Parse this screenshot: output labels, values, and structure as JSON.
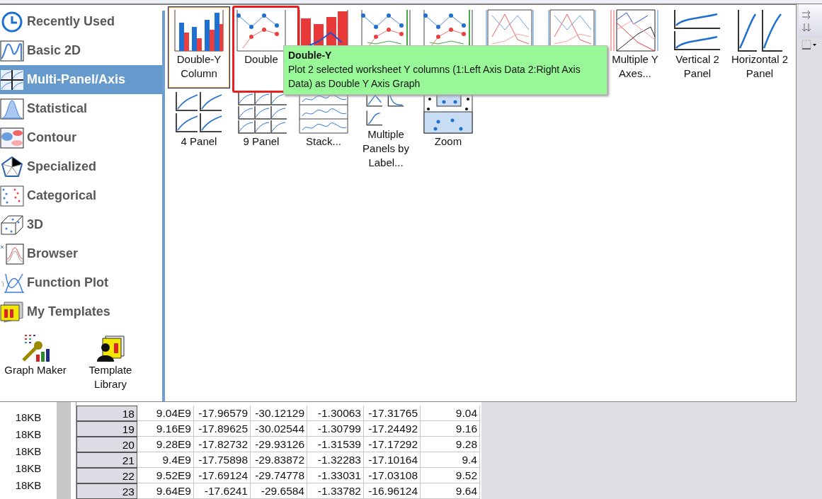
{
  "categories": [
    {
      "label": "Recently Used",
      "selected": false
    },
    {
      "label": "Basic 2D",
      "selected": false
    },
    {
      "label": "Multi-Panel/Axis",
      "selected": true
    },
    {
      "label": "Statistical",
      "selected": false
    },
    {
      "label": "Contour",
      "selected": false
    },
    {
      "label": "Specialized",
      "selected": false
    },
    {
      "label": "Categorical",
      "selected": false
    },
    {
      "label": "3D",
      "selected": false
    },
    {
      "label": "Browser",
      "selected": false
    },
    {
      "label": "Function Plot",
      "selected": false
    },
    {
      "label": "My Templates",
      "selected": false
    }
  ],
  "tools": [
    {
      "label": "Graph Maker"
    },
    {
      "label": "Template Library"
    }
  ],
  "templates": [
    {
      "label": "Double-Y Column",
      "selected": true
    },
    {
      "label": "Double",
      "selected": false
    },
    {
      "selected": false
    },
    {
      "selected": false
    },
    {
      "selected": false
    },
    {
      "selected": false
    },
    {
      "selected": false
    },
    {
      "label": "Multiple Y Axes...",
      "selected": false
    },
    {
      "label": "Vertical 2 Panel",
      "selected": false
    },
    {
      "label": "Horizontal 2 Panel",
      "selected": false
    },
    {
      "label": "4 Panel",
      "selected": false
    },
    {
      "label": "9 Panel",
      "selected": false
    },
    {
      "label": "Stack...",
      "selected": false
    },
    {
      "label": "Multiple Panels by Label...",
      "selected": false
    },
    {
      "label": "Zoom",
      "selected": false
    }
  ],
  "tooltip": {
    "title": "Double-Y",
    "text": "Plot 2 selected worksheet Y columns (1:Left Axis Data 2:Right Axis Data) as Double Y Axis Graph"
  },
  "file_sizes": [
    "18KB",
    "18KB",
    "18KB",
    "18KB",
    "18KB"
  ],
  "worksheet": {
    "rows": [
      [
        "18",
        "9.04E9",
        "-17.96579",
        "-30.12129",
        "-1.30063",
        "-17.31765",
        "9.04"
      ],
      [
        "19",
        "9.16E9",
        "-17.89625",
        "-30.02544",
        "-1.30799",
        "-17.24492",
        "9.16"
      ],
      [
        "20",
        "9.28E9",
        "-17.82732",
        "-29.93126",
        "-1.31539",
        "-17.17292",
        "9.28"
      ],
      [
        "21",
        "9.4E9",
        "-17.75898",
        "-29.83872",
        "-1.32283",
        "-17.10164",
        "9.4"
      ],
      [
        "22",
        "9.52E9",
        "-17.69124",
        "-29.74778",
        "-1.33031",
        "-17.03108",
        "9.52"
      ],
      [
        "23",
        "9.64E9",
        "-17.6241",
        "-29.6584",
        "-1.33782",
        "-16.96124",
        "9.64"
      ]
    ]
  }
}
